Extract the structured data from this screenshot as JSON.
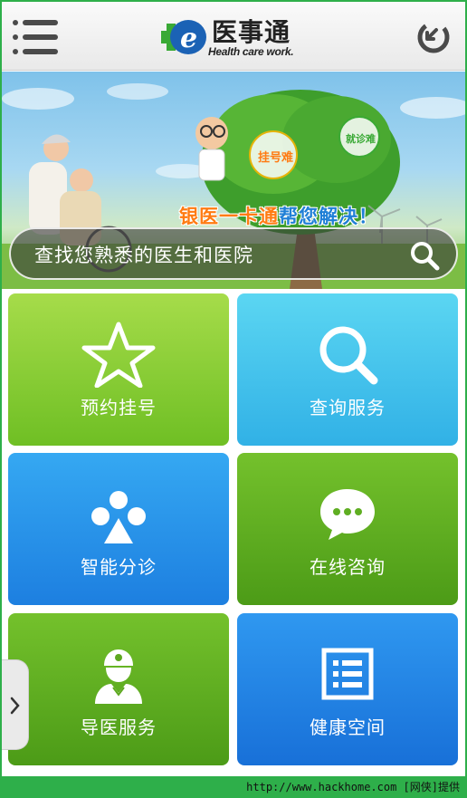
{
  "header": {
    "logo_cn": "医事通",
    "logo_en": "Health care work.",
    "menu_icon": "menu-icon",
    "refresh_icon": "refresh-icon"
  },
  "banner": {
    "slogan_part1": "银医一卡通",
    "slogan_part2": "帮您解决！",
    "bubble1": "挂号难",
    "bubble2": "就诊难"
  },
  "search": {
    "placeholder": "查找您熟悉的医生和医院"
  },
  "tiles": [
    {
      "label": "预约挂号",
      "icon": "star-icon",
      "color": "#8ccd36"
    },
    {
      "label": "查询服务",
      "icon": "search-icon",
      "color": "#46c4ec"
    },
    {
      "label": "智能分诊",
      "icon": "triage-icon",
      "color": "#2993ea"
    },
    {
      "label": "在线咨询",
      "icon": "chat-icon",
      "color": "#5fae22"
    },
    {
      "label": "导医服务",
      "icon": "doctor-icon",
      "color": "#5da81f"
    },
    {
      "label": "健康空间",
      "icon": "list-icon",
      "color": "#2381e4"
    }
  ],
  "side_tab": {
    "icon": "chevron-right-icon"
  },
  "footer": {
    "text": "http://www.hackhome.com [网侠]提供"
  }
}
